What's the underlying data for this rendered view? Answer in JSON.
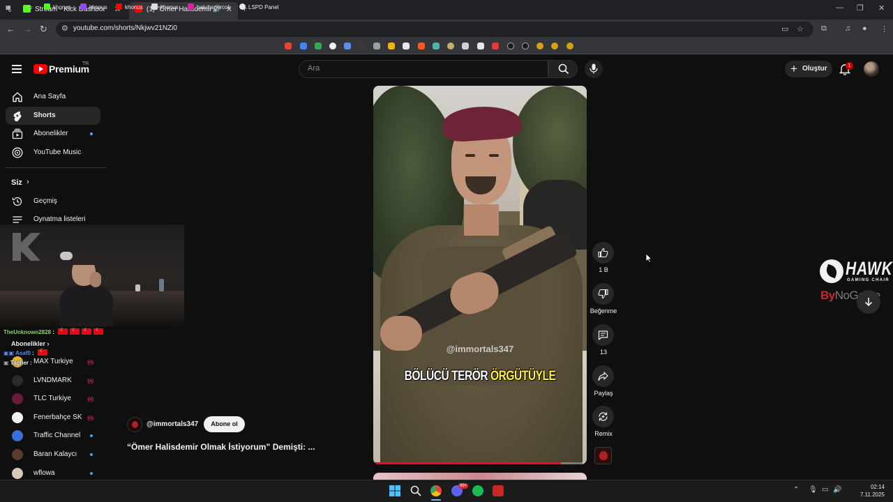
{
  "browser": {
    "tabs": [
      {
        "title": "Stream - Kick Dashboard",
        "favicon_color": "#53fc18"
      },
      {
        "title": "(1) \"Ömer Halisdemir Olma",
        "favicon_color": "#ff0000"
      }
    ],
    "url": "youtube.com/shorts/Nkjwv21NZi0",
    "bookmarks": [
      "khonus",
      "khonus",
      "khonus",
      "khonus",
      "batuhanercok",
      "LSPD Panel"
    ]
  },
  "youtube": {
    "brand": "Premium",
    "region": "TR",
    "search": {
      "placeholder": "Ara",
      "value": ""
    },
    "create_label": "Oluştur",
    "notification_count": "1"
  },
  "sidebar": {
    "main_items": [
      {
        "label": "Ana Sayfa",
        "icon": "home-icon"
      },
      {
        "label": "Shorts",
        "icon": "shorts-icon",
        "active": true
      },
      {
        "label": "Abonelikler",
        "icon": "subscriptions-icon",
        "dot": true
      },
      {
        "label": "YouTube Music",
        "icon": "music-icon"
      }
    ],
    "you_heading": "Siz",
    "you_items": [
      {
        "label": "Geçmiş",
        "icon": "history-icon"
      },
      {
        "label": "Oynatma listeleri",
        "icon": "playlists-icon"
      }
    ],
    "subscriptions_heading": "Abonelikler",
    "subscriptions": [
      {
        "label": "MAX Turkiye",
        "avatar": "#e3b23c",
        "live": true
      },
      {
        "label": "LVNDMARK",
        "avatar": "#2b2b2b",
        "live": true
      },
      {
        "label": "TLC Turkiye",
        "avatar": "#6a1b3b",
        "live": true
      },
      {
        "label": "Fenerbahçe SK",
        "avatar": "#f1f1f1",
        "live": true
      },
      {
        "label": "Traffic Channel",
        "avatar": "#3a6fd8",
        "dot": true
      },
      {
        "label": "Baran Kalaycı",
        "avatar": "#5b3b2b",
        "dot": true
      },
      {
        "label": "wflowa",
        "avatar": "#d9c8b7",
        "dot": true
      }
    ]
  },
  "stream_chat": [
    {
      "user": "TheUnknown2828",
      "color": "#8ed36b",
      "flags": 4
    },
    {
      "user": "Asaf0",
      "color": "#5c8df6",
      "flags": 1
    },
    {
      "user": "Tagher",
      "color": "#f0f0f0",
      "flags": 0
    }
  ],
  "short": {
    "watermark": "@immortals347",
    "caption_white": "BÖLÜCÜ TERÖR",
    "caption_yellow": "ÖRGÜTÜYLE",
    "progress": 0.88,
    "channel": "@immortals347",
    "subscribe_label": "Abone ol",
    "title": "“Ömer Halisdemir Olmak İstiyorum” Demişti: ..."
  },
  "actions": {
    "like_count": "1 B",
    "dislike_label": "Beğenme",
    "comment_count": "13",
    "share_label": "Paylaş",
    "remix_label": "Remix"
  },
  "overlay": {
    "sponsor": "HAWK",
    "sponsor_sub": "GAMING CHAIR",
    "partner_b": "By",
    "partner_rest": "NoGame"
  },
  "taskbar": {
    "time": "02:14",
    "date": "7.11.2025",
    "discord_badge": "99+"
  }
}
